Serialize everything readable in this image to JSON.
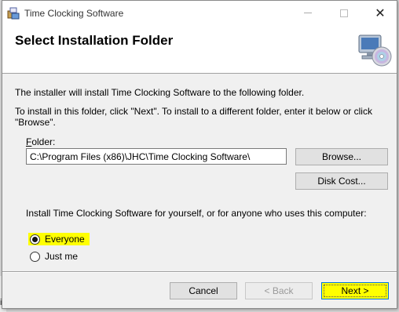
{
  "background": {
    "partial_text": "iicsrto"
  },
  "window": {
    "title": "Time Clocking Software",
    "controls": {
      "close_glyph": "✕"
    }
  },
  "header": {
    "title": "Select Installation Folder",
    "icon": "computer-cd-icon"
  },
  "body": {
    "description_1": "The installer will install Time Clocking Software to the following folder.",
    "description_2": "To install in this folder, click \"Next\". To install to a different folder, enter it below or click \"Browse\".",
    "folder_label_prefix": "F",
    "folder_label_rest": "older:",
    "folder_value": "C:\\Program Files (x86)\\JHC\\Time Clocking Software\\",
    "browse_label": "Browse...",
    "disk_cost_label": "Disk Cost...",
    "install_for_text": "Install Time Clocking Software for yourself, or for anyone who uses this computer:",
    "options": [
      {
        "label": "Everyone",
        "selected": true
      },
      {
        "label": "Just me",
        "selected": false
      }
    ]
  },
  "footer": {
    "cancel_label": "Cancel",
    "back_label": "< Back",
    "next_label": "Next >"
  },
  "colors": {
    "highlight": "#ffff00",
    "focus_border": "#0078d7",
    "dialog_bg": "#f0f0f0"
  }
}
